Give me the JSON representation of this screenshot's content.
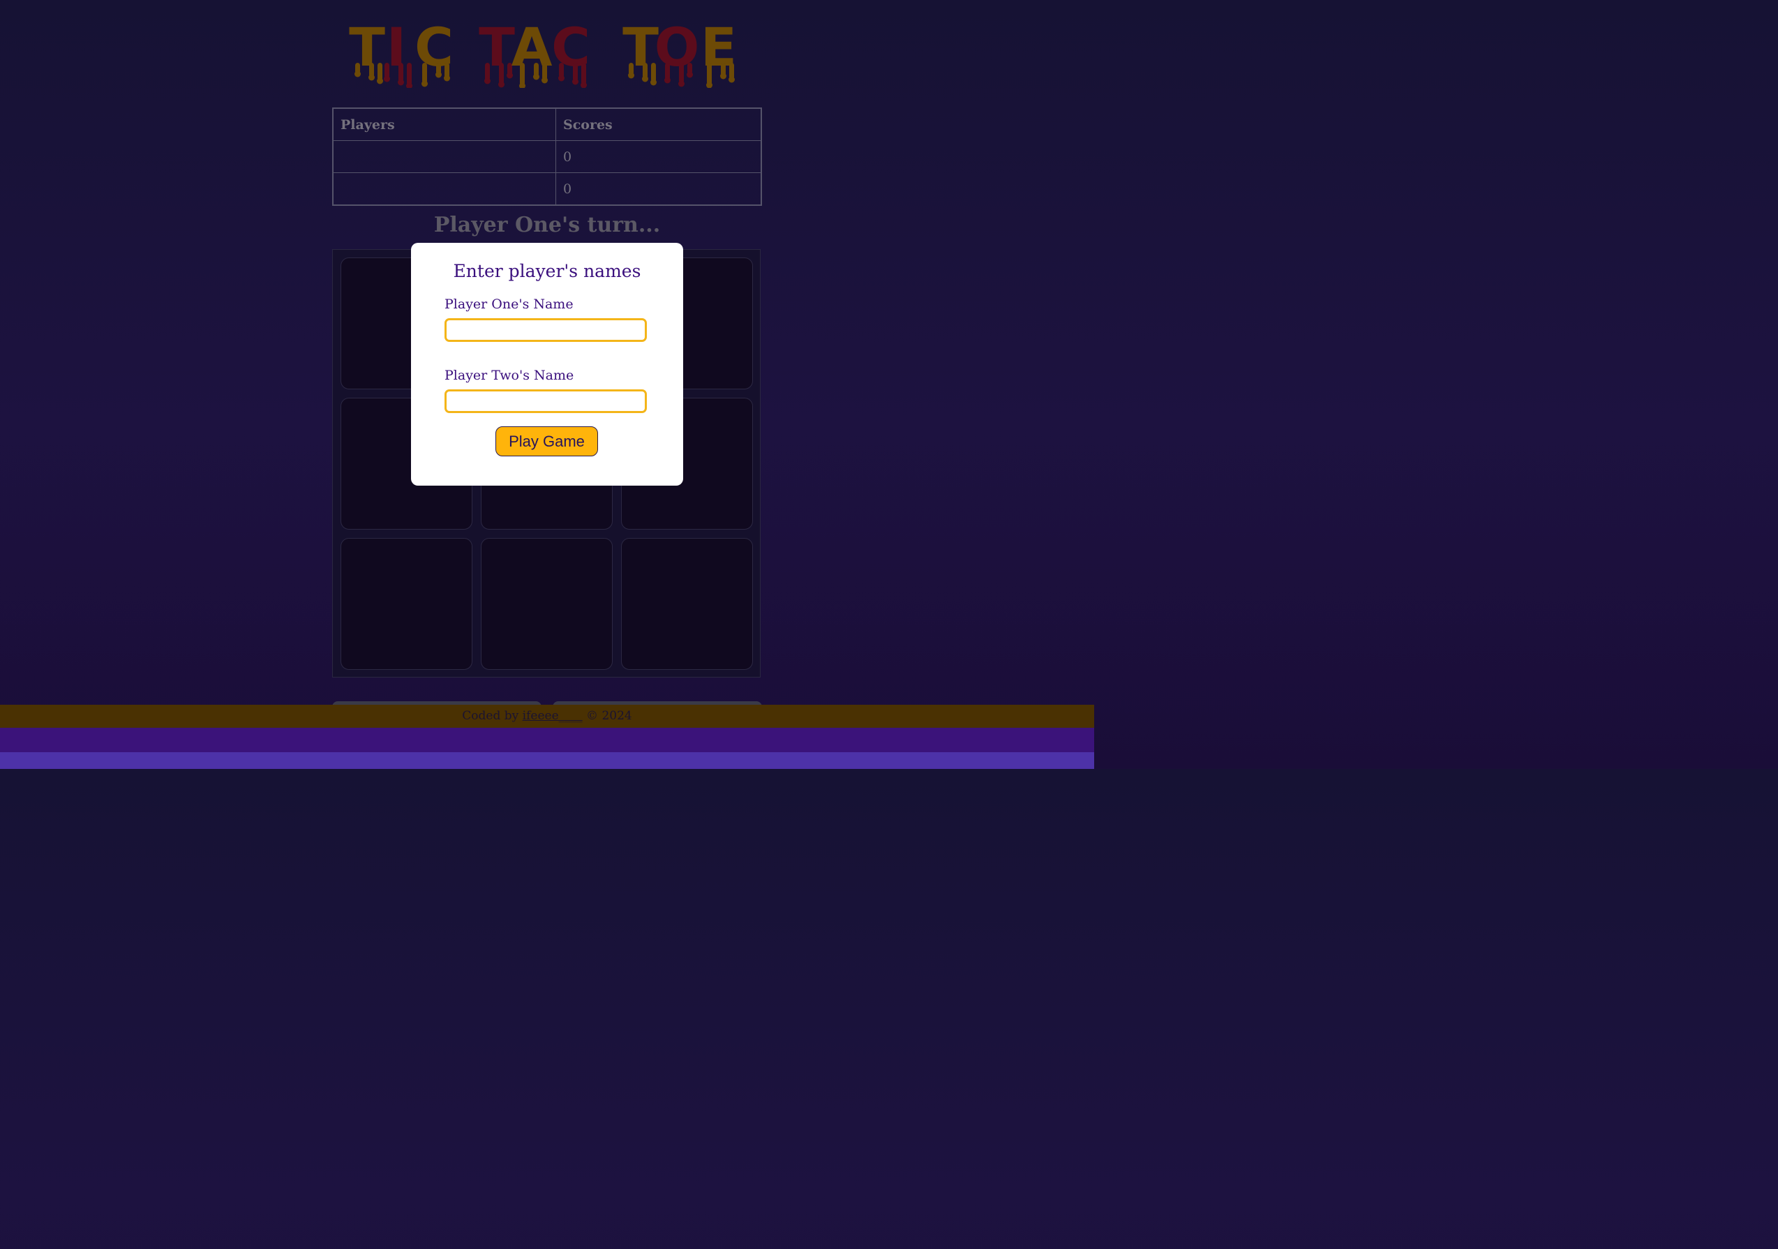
{
  "title": {
    "letters": [
      "T",
      "I",
      "C",
      " ",
      "T",
      "A",
      "C",
      " ",
      "T",
      "O",
      "E"
    ],
    "colors": {
      "gold": "#6d4a06",
      "red": "#5c0c1c"
    }
  },
  "scoreboard": {
    "headers": {
      "players": "Players",
      "scores": "Scores"
    },
    "rows": [
      {
        "name": "",
        "score": "0"
      },
      {
        "name": "",
        "score": "0"
      }
    ]
  },
  "status": {
    "turn_text": "Player One's turn..."
  },
  "board": {
    "cells": [
      "",
      "",
      "",
      "",
      "",
      "",
      "",
      "",
      ""
    ]
  },
  "footer": {
    "prefix": "Coded by ",
    "author": "ifeeee____",
    "suffix": " © 2024"
  },
  "modal": {
    "title": "Enter player's names",
    "player_one_label": "Player One's Name",
    "player_one_value": "",
    "player_two_label": "Player Two's Name",
    "player_two_value": "",
    "play_button": "Play Game"
  },
  "colors": {
    "accent": "#ffb40b",
    "modal_text": "#3a0f7d",
    "footer_bg": "#4a3102",
    "bar_purple": "#3b137a",
    "bar_violet": "#4d32a8"
  }
}
